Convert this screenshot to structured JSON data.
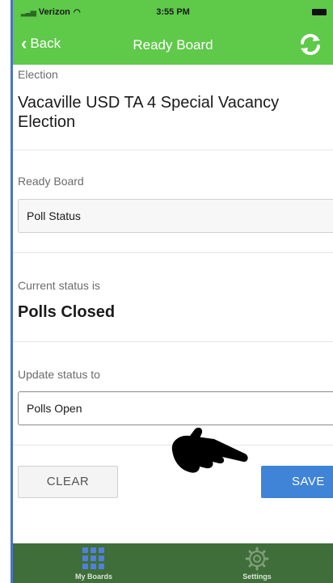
{
  "status_bar": {
    "carrier": "Verizon",
    "time": "3:55 PM"
  },
  "nav": {
    "back_label": "Back",
    "title": "Ready Board"
  },
  "election": {
    "label": "Election",
    "value": "Vacaville USD TA 4 Special Vacancy Election"
  },
  "ready_board": {
    "label": "Ready Board",
    "value": "Poll Status"
  },
  "current_status": {
    "label": "Current status is",
    "value": "Polls Closed"
  },
  "update_status": {
    "label": "Update status to",
    "value": "Polls Open"
  },
  "actions": {
    "clear_label": "CLEAR",
    "save_label": "SAVE"
  },
  "tabs": [
    {
      "label": "My Boards",
      "icon": "grid-icon",
      "active": true
    },
    {
      "label": "Settings",
      "icon": "gear-icon",
      "active": false
    }
  ],
  "colors": {
    "header_green": "#5fc94a",
    "tab_bar_green": "#3f6e3a",
    "save_blue": "#3f84d6",
    "active_tab_icon": "#4f7fe0"
  }
}
